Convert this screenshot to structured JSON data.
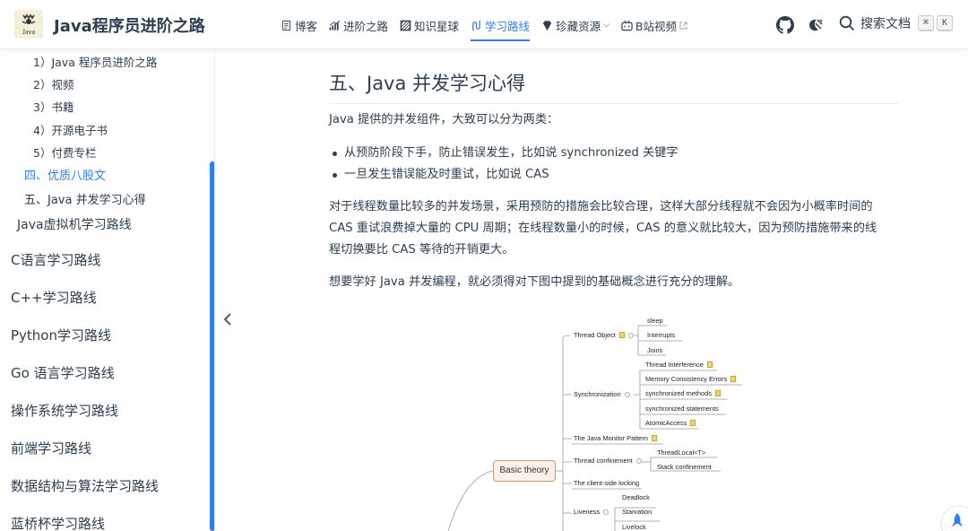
{
  "header": {
    "logo_text": "Java",
    "site_title": "Java程序员进阶之路",
    "nav": [
      {
        "label": "博客",
        "icon": "doc-icon"
      },
      {
        "label": "进阶之路",
        "icon": "chart-icon"
      },
      {
        "label": "知识星球",
        "icon": "planet-icon"
      },
      {
        "label": "学习路线",
        "icon": "route-icon",
        "active": true
      },
      {
        "label": "珍藏资源",
        "icon": "gem-icon",
        "dropdown": true
      },
      {
        "label": "B站视频",
        "icon": "tv-icon",
        "external": true
      }
    ],
    "search_label": "搜索文档",
    "search_keys": [
      "⌘",
      "K"
    ],
    "accent_color": "#2f7ef0"
  },
  "sidebar": {
    "sub_items": [
      "1）Java 程序员进阶之路",
      "2）视频",
      "3）书籍",
      "4）开源电子书",
      "5）付费专栏"
    ],
    "h3_items": [
      {
        "label": "四、优质八股文",
        "active": true
      },
      {
        "label": "五、Java 并发学习心得",
        "active": false
      }
    ],
    "h2_items": [
      "Java虚拟机学习路线"
    ],
    "groups": [
      "C语言学习路线",
      "C++学习路线",
      "Python学习路线",
      "Go 语言学习路线",
      "操作系统学习路线",
      "前端学习路线",
      "数据结构与算法学习路线",
      "蓝桥杯学习路线"
    ]
  },
  "content": {
    "heading": "五、Java 并发学习心得",
    "intro": "Java 提供的并发组件，大致可以分为两类：",
    "bullets": [
      "从预防阶段下手，防止错误发生，比如说 synchronized 关键字",
      "一旦发生错误能及时重试，比如说 CAS"
    ],
    "para_lines": [
      "对于线程数量比较多的并发场景，采用预防的措施会比较合理，这样大部分线程就不会因为小概率时间的",
      "CAS 重试浪费掉大量的 CPU 周期；在线程数量小的时候，CAS 的意义就比较大，因为预防措施带来的线",
      "程切换要比 CAS 等待的开销更大。"
    ],
    "para2": "想要学好 Java 并发编程，就必须得对下图中提到的基础概念进行充分的理解。"
  },
  "mindmap": {
    "root": "Basic theory",
    "thread_object": "Thread Object",
    "thread_object_children": [
      "sleep",
      "Interrupts",
      "Joins"
    ],
    "synchronization": "Synchronization",
    "sync_children": [
      "Thread Interference",
      "Memory Consistency Errors",
      "synchronized methods",
      "synchronized statements",
      "AtomicAccess"
    ],
    "monitor": "The Java Monitor Pattern",
    "confinement": "Thread confinement",
    "confinement_children": [
      "ThreadLocal<T>",
      "Stack confinement"
    ],
    "client_locking": "The client-side locking",
    "liveness": "Liveness",
    "liveness_children": [
      "Deadlock",
      "Starvation",
      "Livelock"
    ]
  }
}
